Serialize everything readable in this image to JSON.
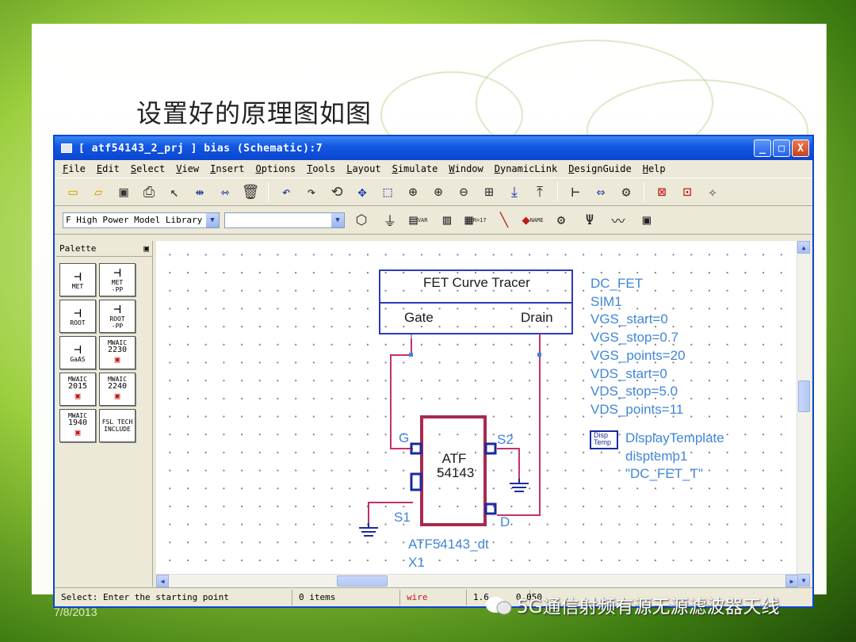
{
  "slide": {
    "title": "设置好的原理图如图",
    "date": "7/8/2013",
    "watermark": "5G通信射频有源无源滤波器天线"
  },
  "window": {
    "title": "[ atf54143_2_prj ] bias (Schematic):7",
    "controls": {
      "minimize": "_",
      "maximize": "□",
      "close": "X"
    },
    "menu": [
      "File",
      "Edit",
      "Select",
      "View",
      "Insert",
      "Options",
      "Tools",
      "Layout",
      "Simulate",
      "Window",
      "DynamicLink",
      "DesignGuide",
      "Help"
    ],
    "library_select": "F High Power Model Library",
    "component_select": "",
    "toolbar2_labels": {
      "var": "VAR",
      "r17": "R=17",
      "name": "NAME"
    }
  },
  "palette": {
    "title": "Palette",
    "items": [
      {
        "line1": "MET",
        "line2": ""
      },
      {
        "line1": "MET",
        "line2": "-PP"
      },
      {
        "line1": "ROOT",
        "line2": ""
      },
      {
        "line1": "ROOT",
        "line2": "-PP"
      },
      {
        "line1": "GaAS",
        "line2": ""
      },
      {
        "line1": "MWAIC",
        "line2": "2230"
      },
      {
        "line1": "MWAIC",
        "line2": "2015"
      },
      {
        "line1": "MWAIC",
        "line2": "2240"
      },
      {
        "line1": "MWAIC",
        "line2": "1940"
      },
      {
        "line1": "FSL TECH",
        "line2": "INCLUDE"
      }
    ]
  },
  "schematic": {
    "tracer": {
      "title": "FET Curve Tracer",
      "gate": "Gate",
      "drain": "Drain"
    },
    "dc_params": [
      "DC_FET",
      "SIM1",
      "VGS_start=0",
      "VGS_stop=0.7",
      "VGS_points=20",
      "VDS_start=0",
      "VDS_stop=5.0",
      "VDS_points=11"
    ],
    "display": {
      "icon_line1": "Disp",
      "icon_line2": "Temp",
      "lines": [
        "DisplayTemplate",
        "disptemp1",
        "\"DC_FET_T\""
      ]
    },
    "transistor": {
      "line1": "ATF",
      "line2": "54143",
      "pin_g": "G",
      "pin_s2": "S2",
      "pin_s1": "S1",
      "pin_d": "D",
      "name": "ATF54143_dt",
      "instance": "X1"
    }
  },
  "status": {
    "message": "Select: Enter the starting point",
    "items": "0 items",
    "mode": "wire",
    "coords": "1.6",
    "coords2": "0.050"
  },
  "colors": {
    "wire": "#c4306e",
    "label_blue": "#3f86d8",
    "titlebar": "#0a46d0"
  }
}
